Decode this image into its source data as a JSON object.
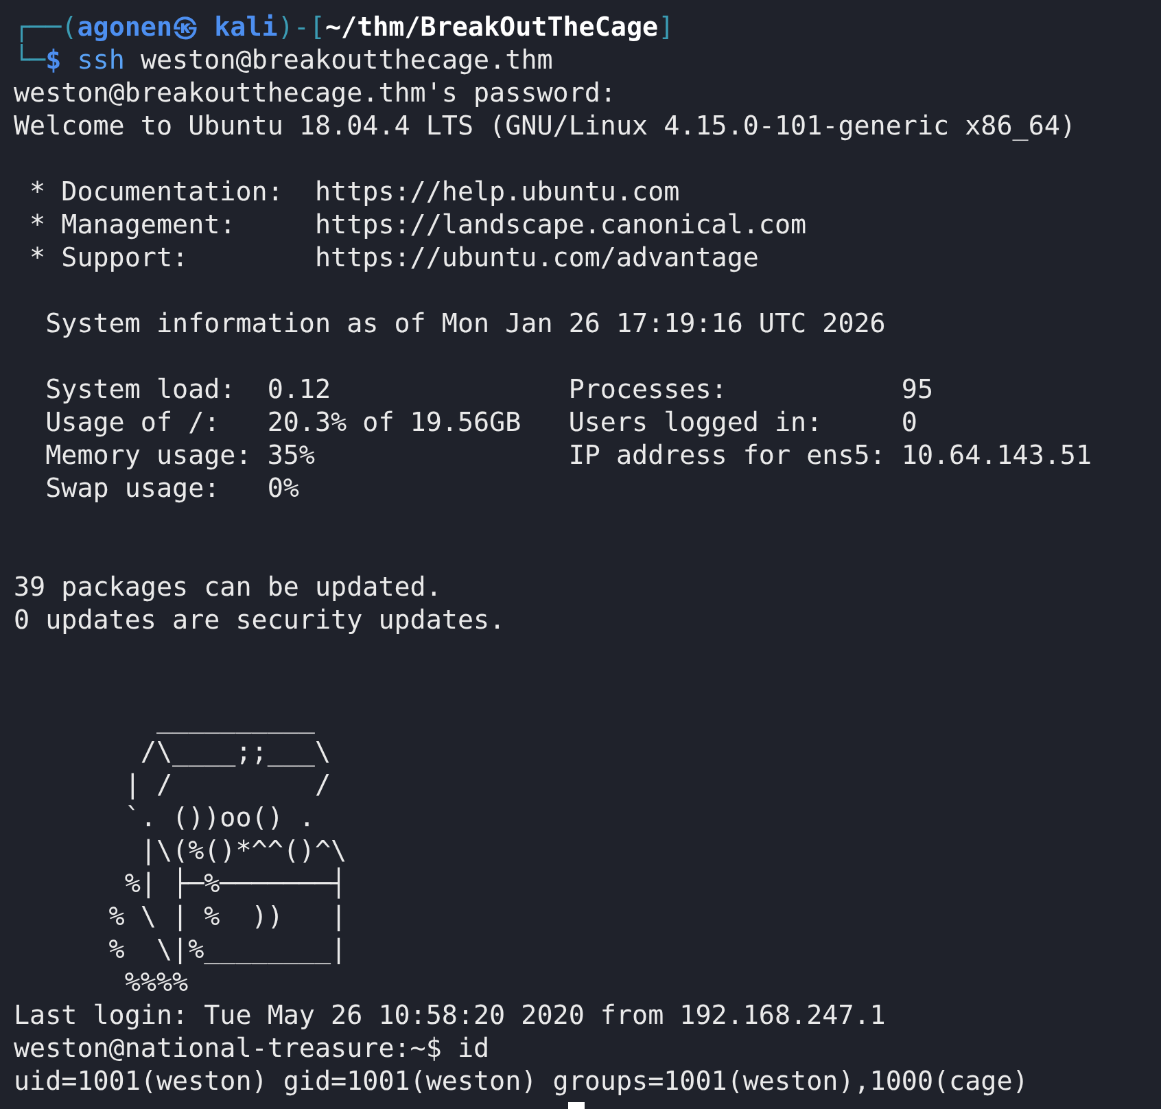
{
  "prompt": {
    "open": "┌──(",
    "user": "agonen",
    "separator": "㉿",
    "host": "kali",
    "middle": ")-[",
    "path": "~/thm/BreakOutTheCage",
    "close": "]",
    "corner": "└─",
    "symbol": "$",
    "command": "ssh",
    "arguments": "weston@breakoutthecage.thm"
  },
  "output": [
    {
      "kind": "text",
      "text": "weston@breakoutthecage.thm's password:"
    },
    {
      "kind": "text",
      "text": "Welcome to Ubuntu 18.04.4 LTS (GNU/Linux 4.15.0-101-generic x86_64)"
    },
    {
      "kind": "blank"
    },
    {
      "kind": "text",
      "text": " * Documentation:  https://help.ubuntu.com"
    },
    {
      "kind": "text",
      "text": " * Management:     https://landscape.canonical.com"
    },
    {
      "kind": "text",
      "text": " * Support:        https://ubuntu.com/advantage"
    },
    {
      "kind": "blank"
    },
    {
      "kind": "text",
      "text": "  System information as of Mon Jan 26 17:19:16 UTC 2026"
    },
    {
      "kind": "blank"
    },
    {
      "kind": "text",
      "text": "  System load:  0.12               Processes:           95"
    },
    {
      "kind": "text",
      "text": "  Usage of /:   20.3% of 19.56GB   Users logged in:     0"
    },
    {
      "kind": "text",
      "text": "  Memory usage: 35%                IP address for ens5: 10.64.143.51"
    },
    {
      "kind": "text",
      "text": "  Swap usage:   0%"
    },
    {
      "kind": "blank"
    },
    {
      "kind": "blank"
    },
    {
      "kind": "text",
      "text": "39 packages can be updated."
    },
    {
      "kind": "text",
      "text": "0 updates are security updates."
    },
    {
      "kind": "blank"
    },
    {
      "kind": "blank"
    },
    {
      "kind": "art",
      "text": "         __________"
    },
    {
      "kind": "art",
      "text": "        /\\____;;___\\"
    },
    {
      "kind": "art",
      "text": "       | /         /"
    },
    {
      "kind": "art",
      "text": "       `. ())oo() ."
    },
    {
      "kind": "art",
      "text": "        |\\(%()*^^()^\\"
    },
    {
      "kind": "art",
      "text": "       %| ├─%───────┤"
    },
    {
      "kind": "art",
      "text": "      % \\ | %  ))   |"
    },
    {
      "kind": "art",
      "text": "      %  \\|%________|"
    },
    {
      "kind": "art",
      "text": "       %%%%"
    },
    {
      "kind": "text",
      "text": "Last login: Tue May 26 10:58:20 2020 from 192.168.247.1"
    },
    {
      "kind": "text",
      "text": "weston@national-treasure:~$ id"
    },
    {
      "kind": "text",
      "text": "uid=1001(weston) gid=1001(weston) groups=1001(weston),1000(cage)"
    },
    {
      "kind": "cursor"
    }
  ]
}
